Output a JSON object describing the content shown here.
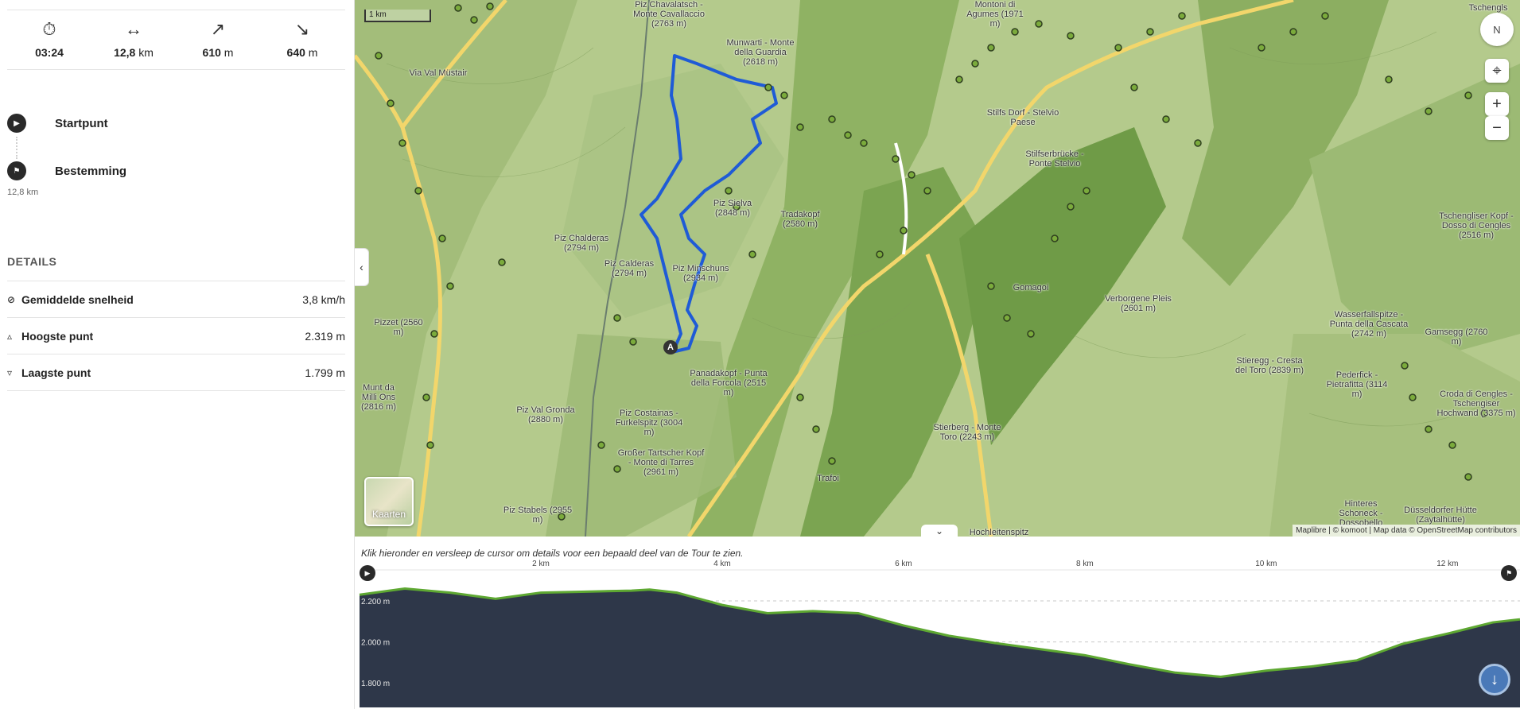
{
  "stats": [
    {
      "icon": "stopwatch-icon",
      "glyph": "⏱",
      "value": "03:24",
      "unit": ""
    },
    {
      "icon": "distance-icon",
      "glyph": "↔",
      "value": "12,8",
      "unit": "km"
    },
    {
      "icon": "ascent-icon",
      "glyph": "↗",
      "value": "610",
      "unit": "m"
    },
    {
      "icon": "descent-icon",
      "glyph": "↘",
      "value": "640",
      "unit": "m"
    }
  ],
  "waypoints": {
    "start_label": "Startpunt",
    "end_label": "Bestemming",
    "distance": "12,8 km"
  },
  "details": {
    "title": "DETAILS",
    "rows": [
      {
        "icon": "speed-icon",
        "label": "Gemiddelde snelheid",
        "value": "3,8 km/h"
      },
      {
        "icon": "highest-point-icon",
        "label": "Hoogste punt",
        "value": "2.319 m"
      },
      {
        "icon": "lowest-point-icon",
        "label": "Laagste punt",
        "value": "1.799 m"
      }
    ]
  },
  "map": {
    "scale_label": "1 km",
    "compass_label": "N",
    "layer_button_label": "Kaarten",
    "attribution": "Maplibre | © komoot | Map data © OpenStreetMap contributors",
    "marker_label": "A",
    "labels": [
      "Piz Chavalatsch - Monte Cavallaccio (2763 m)",
      "Munwarti - Monte della Guardia (2618 m)",
      "Montoni di Agumes (1971 m)",
      "Stilfs Dorf - Stelvio Paese",
      "Stilfserbrücke - Ponte Stelvio",
      "Piz Sielva (2848 m)",
      "Tradakopf (2580 m)",
      "Piz Chalderas (2794 m)",
      "Piz Calderas (2794 m)",
      "Piz Minschuns (2934 m)",
      "Pizzet (2560 m)",
      "Munt da Milli Ons (2816 m)",
      "Piz Val Gronda (2880 m)",
      "Panadakopf - Punta della Forcola (2515 m)",
      "Piz Costainas - Furkelspitz (3004 m)",
      "Großer Tartscher Kopf - Monte di Tarres (2961 m)",
      "Piz Stabels (2955 m)",
      "Trafoi",
      "Stierberg - Monte Toro (2243 m)",
      "Verborgene Pleis (2601 m)",
      "Stieregg - Cresta del Toro (2839 m)",
      "Wasserfallspitze - Punta della Cascata (2742 m)",
      "Pederfick - Pietrafitta (3114 m)",
      "Gamsegg (2760 m)",
      "Tschengliser Kopf - Dosso di Cengles (2516 m)",
      "Croda di Cengles - Tschengiser Hochwand (3375 m)",
      "Hinteres Schoneck - Dossobello",
      "Düsseldorfer Hütte (Zaytalhütte)",
      "Hochleitenspitz",
      "Via Val Müstair",
      "Gomagoi",
      "Tschengls"
    ]
  },
  "elevation": {
    "hint": "Klik hieronder en versleep de cursor om details voor een bepaald deel van de Tour te zien.",
    "km_ticks": [
      "2 km",
      "4 km",
      "6 km",
      "8 km",
      "10 km",
      "12 km"
    ],
    "elev_ticks": [
      "2.200 m",
      "2.000 m",
      "1.800 m"
    ],
    "start_icon": "▶",
    "end_icon": "⚑"
  },
  "chart_data": {
    "type": "area",
    "xlabel": "",
    "ylabel": "",
    "x_unit": "km",
    "y_unit": "m",
    "xlim": [
      0,
      12.8
    ],
    "ylim": [
      1700,
      2320
    ],
    "x": [
      0,
      0.5,
      1,
      1.5,
      2,
      2.5,
      3,
      3.2,
      3.5,
      4,
      4.5,
      5,
      5.5,
      6,
      6.5,
      7,
      7.5,
      8,
      8.5,
      9,
      9.5,
      10,
      10.5,
      11,
      11.5,
      12,
      12.5,
      12.8
    ],
    "series": [
      {
        "values": [
          2230,
          2260,
          2240,
          2210,
          2240,
          2245,
          2250,
          2255,
          2240,
          2180,
          2140,
          2150,
          2140,
          2080,
          2030,
          1995,
          1965,
          1935,
          1890,
          1850,
          1830,
          1860,
          1880,
          1910,
          1990,
          2040,
          2095,
          2110
        ]
      }
    ],
    "colors": {
      "fill": "#2e3749",
      "stroke_low": "#5ea832",
      "stroke_high": "#d99a3a",
      "stroke_steep": "#b3262c"
    }
  },
  "colors": {
    "route": "#1f5bd6",
    "poi_fill": "#7bab3c",
    "road": "#f2d66b"
  }
}
